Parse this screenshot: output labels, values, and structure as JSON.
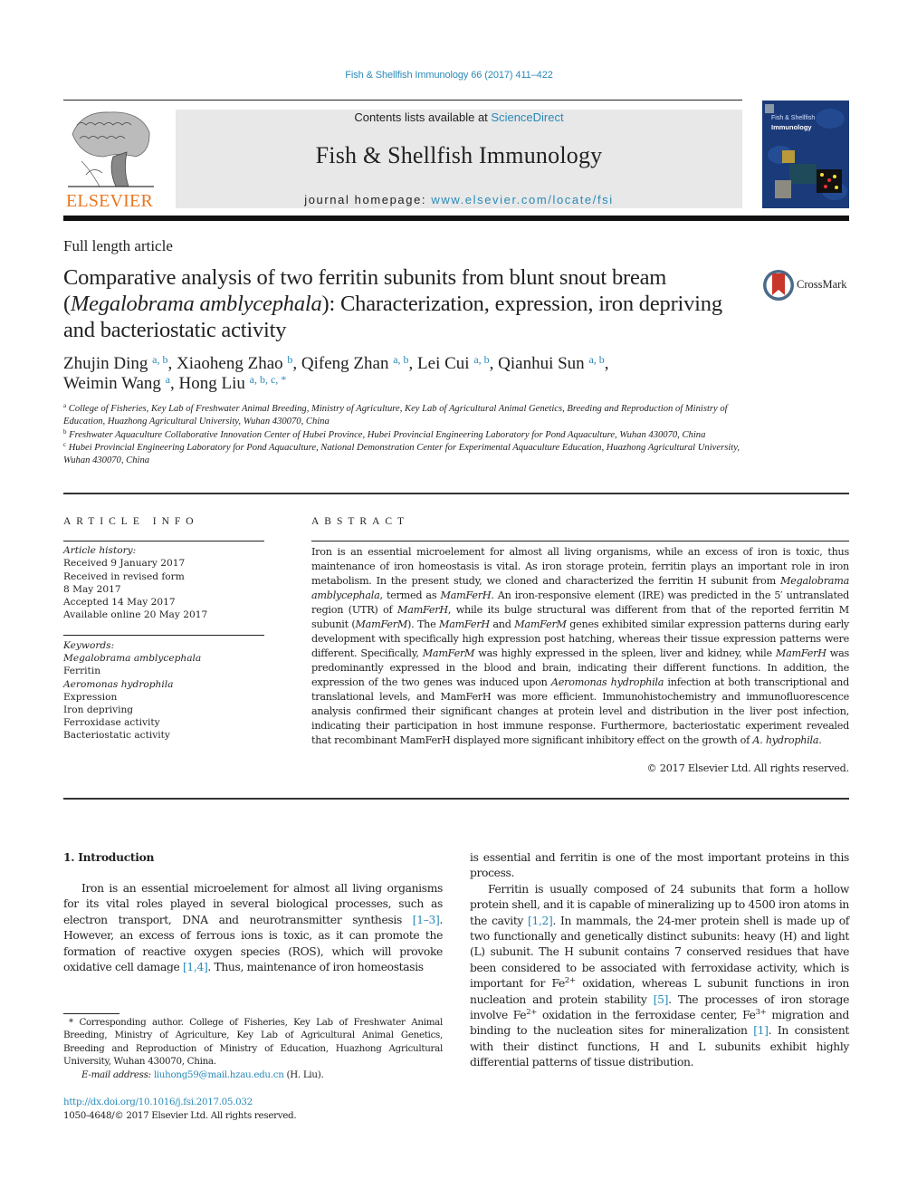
{
  "header": {
    "running_head": "Fish & Shellfish Immunology 66 (2017) 411–422",
    "publisher_logo_text": "ELSEVIER",
    "contents_prefix": "Contents lists available at ",
    "contents_link": "ScienceDirect",
    "journal_name": "Fish & Shellfish Immunology",
    "homepage_prefix": "journal homepage: ",
    "homepage_link": "www.elsevier.com/locate/fsi",
    "cover_title_line1": "Fish & Shellfish",
    "cover_title_line2": "Immunology",
    "crossmark_label": "CrossMark"
  },
  "article": {
    "type": "Full length article",
    "title_part1": "Comparative analysis of two ferritin subunits from blunt snout bream (",
    "title_species": "Megalobrama amblycephala",
    "title_part2": "): Characterization, expression, iron depriving and bacteriostatic activity",
    "authors": [
      {
        "name": "Zhujin Ding",
        "aff": "a, b",
        "sep": ", "
      },
      {
        "name": "Xiaoheng Zhao",
        "aff": "b",
        "sep": ", "
      },
      {
        "name": "Qifeng Zhan",
        "aff": "a, b",
        "sep": ", "
      },
      {
        "name": "Lei Cui",
        "aff": "a, b",
        "sep": ", "
      },
      {
        "name": "Qianhui Sun",
        "aff": "a, b",
        "sep": ","
      },
      {
        "name": "Weimin Wang",
        "aff": "a",
        "sep": ", "
      },
      {
        "name": "Hong Liu",
        "aff": "a, b, c, *",
        "sep": ""
      }
    ],
    "affiliations": [
      {
        "key": "a",
        "text": "College of Fisheries, Key Lab of Freshwater Animal Breeding, Ministry of Agriculture, Key Lab of Agricultural Animal Genetics, Breeding and Reproduction of Ministry of Education, Huazhong Agricultural University, Wuhan 430070, China"
      },
      {
        "key": "b",
        "text": "Freshwater Aquaculture Collaborative Innovation Center of Hubei Province, Hubei Provincial Engineering Laboratory for Pond Aquaculture, Wuhan 430070, China"
      },
      {
        "key": "c",
        "text": "Hubei Provincial Engineering Laboratory for Pond Aquaculture, National Demonstration Center for Experimental Aquaculture Education, Huazhong Agricultural University, Wuhan 430070, China"
      }
    ]
  },
  "article_info": {
    "heading": "ARTICLE INFO",
    "history_label": "Article history:",
    "history": [
      "Received 9 January 2017",
      "Received in revised form",
      "8 May 2017",
      "Accepted 14 May 2017",
      "Available online 20 May 2017"
    ],
    "keywords_label": "Keywords:",
    "keywords": [
      {
        "text": "Megalobrama amblycephala",
        "italic": true
      },
      {
        "text": "Ferritin",
        "italic": false
      },
      {
        "text": "Aeromonas hydrophila",
        "italic": true
      },
      {
        "text": "Expression",
        "italic": false
      },
      {
        "text": "Iron depriving",
        "italic": false
      },
      {
        "text": "Ferroxidase activity",
        "italic": false
      },
      {
        "text": "Bacteriostatic activity",
        "italic": false
      }
    ]
  },
  "abstract": {
    "heading": "ABSTRACT",
    "segments": [
      {
        "t": "Iron is an essential microelement for almost all living organisms, while an excess of iron is toxic, thus maintenance of iron homeostasis is vital. As iron storage protein, ferritin plays an important role in iron metabolism. In the present study, we cloned and characterized the ferritin H subunit from "
      },
      {
        "t": "Megalobrama amblycephala",
        "i": true
      },
      {
        "t": ", termed as "
      },
      {
        "t": "MamFerH",
        "i": true
      },
      {
        "t": ". An iron-responsive element (IRE) was predicted in the 5′ untrans­lated region (UTR) of "
      },
      {
        "t": "MamFerH",
        "i": true
      },
      {
        "t": ", while its bulge structural was different from that of the reported ferritin M subunit ("
      },
      {
        "t": "MamFerM",
        "i": true
      },
      {
        "t": "). The "
      },
      {
        "t": "MamFerH",
        "i": true
      },
      {
        "t": " and "
      },
      {
        "t": "MamFerM",
        "i": true
      },
      {
        "t": " genes exhibited similar expression patterns during early development with specifically high expression post hatching, whereas their tissue expression patterns were different. Specifically, "
      },
      {
        "t": "MamFerM",
        "i": true
      },
      {
        "t": " was highly expressed in the spleen, liver and kidney, while "
      },
      {
        "t": "MamFerH",
        "i": true
      },
      {
        "t": " was predominantly expressed in the blood and brain, indicating their different functions. In addition, the expression of the two genes was induced upon "
      },
      {
        "t": "Aeromonas hydrophila",
        "i": true
      },
      {
        "t": " infection at both transcriptional and translational levels, and MamFerH was more efficient. Immunohistochemistry and immunofluorescence analysis confirmed their significant changes at protein level and distribution in the liver post infection, indicating their participation in host immune response. Furthermore, bacteriostatic experiment revealed that recombinant MamFerH displayed more significant inhibitory effect on the growth of "
      },
      {
        "t": "A. hydrophila",
        "i": true
      },
      {
        "t": "."
      }
    ],
    "copyright": "© 2017 Elsevier Ltd. All rights reserved."
  },
  "introduction": {
    "heading": "1.  Introduction",
    "left_paragraph": [
      {
        "t": "Iron is an essential microelement for almost all living organisms for its vital roles played in several biological processes, such as electron transport, DNA and neurotransmitter synthesis "
      },
      {
        "t": "[1–3]",
        "ref": true
      },
      {
        "t": ". However, an excess of ferrous ions is toxic, as it can promote the formation of reactive oxygen species (ROS), which will provoke oxidative cell damage "
      },
      {
        "t": "[1,4]",
        "ref": true
      },
      {
        "t": ". Thus, maintenance of iron homeostasis"
      }
    ],
    "right_continuation": "is essential and ferritin is one of the most important proteins in this process.",
    "right_paragraph": [
      {
        "t": "Ferritin is usually composed of 24 subunits that form a hollow protein shell, and it is capable of mineralizing up to 4500 iron atoms in the cavity "
      },
      {
        "t": "[1,2]",
        "ref": true
      },
      {
        "t": ". In mammals, the 24-mer protein shell is made up of two functionally and genetically distinct subunits: heavy (H) and light (L) subunit. The H subunit contains 7 conserved residues that have been considered to be associated with ferrox­idase activity, which is important for Fe"
      },
      {
        "t": "2+",
        "sup": true
      },
      {
        "t": " oxidation, whereas L subunit functions in iron nucleation and protein stability "
      },
      {
        "t": "[5]",
        "ref": true
      },
      {
        "t": ". The processes of iron storage involve Fe"
      },
      {
        "t": "2+",
        "sup": true
      },
      {
        "t": " oxidation in the ferroxidase center, Fe"
      },
      {
        "t": "3+",
        "sup": true
      },
      {
        "t": " migration and binding to the nucleation sites for mineralization "
      },
      {
        "t": "[1]",
        "ref": true
      },
      {
        "t": ". In consistent with their distinct functions, H and L subunits exhibit highly differential patterns of tissue distribution."
      }
    ]
  },
  "footnote": {
    "corresponding": "* Corresponding author. College of Fisheries, Key Lab of Freshwater Animal Breeding, Ministry of Agriculture, Key Lab of Agricultural Animal Genetics, Breeding and Reproduction of Ministry of Education, Huazhong Agricultural University, Wuhan 430070, China.",
    "email_label": "E-mail address: ",
    "email": "liuhong59@mail.hzau.edu.cn",
    "email_suffix": " (H. Liu).",
    "doi": "http://dx.doi.org/10.1016/j.fsi.2017.05.032",
    "issn": "1050-4648/© 2017 Elsevier Ltd. All rights reserved."
  },
  "colors": {
    "link": "#2a8ab8",
    "elsevier_orange": "#e87722",
    "banner_gray": "#e8e8e8",
    "cover_blue": "#1a3a7a"
  }
}
